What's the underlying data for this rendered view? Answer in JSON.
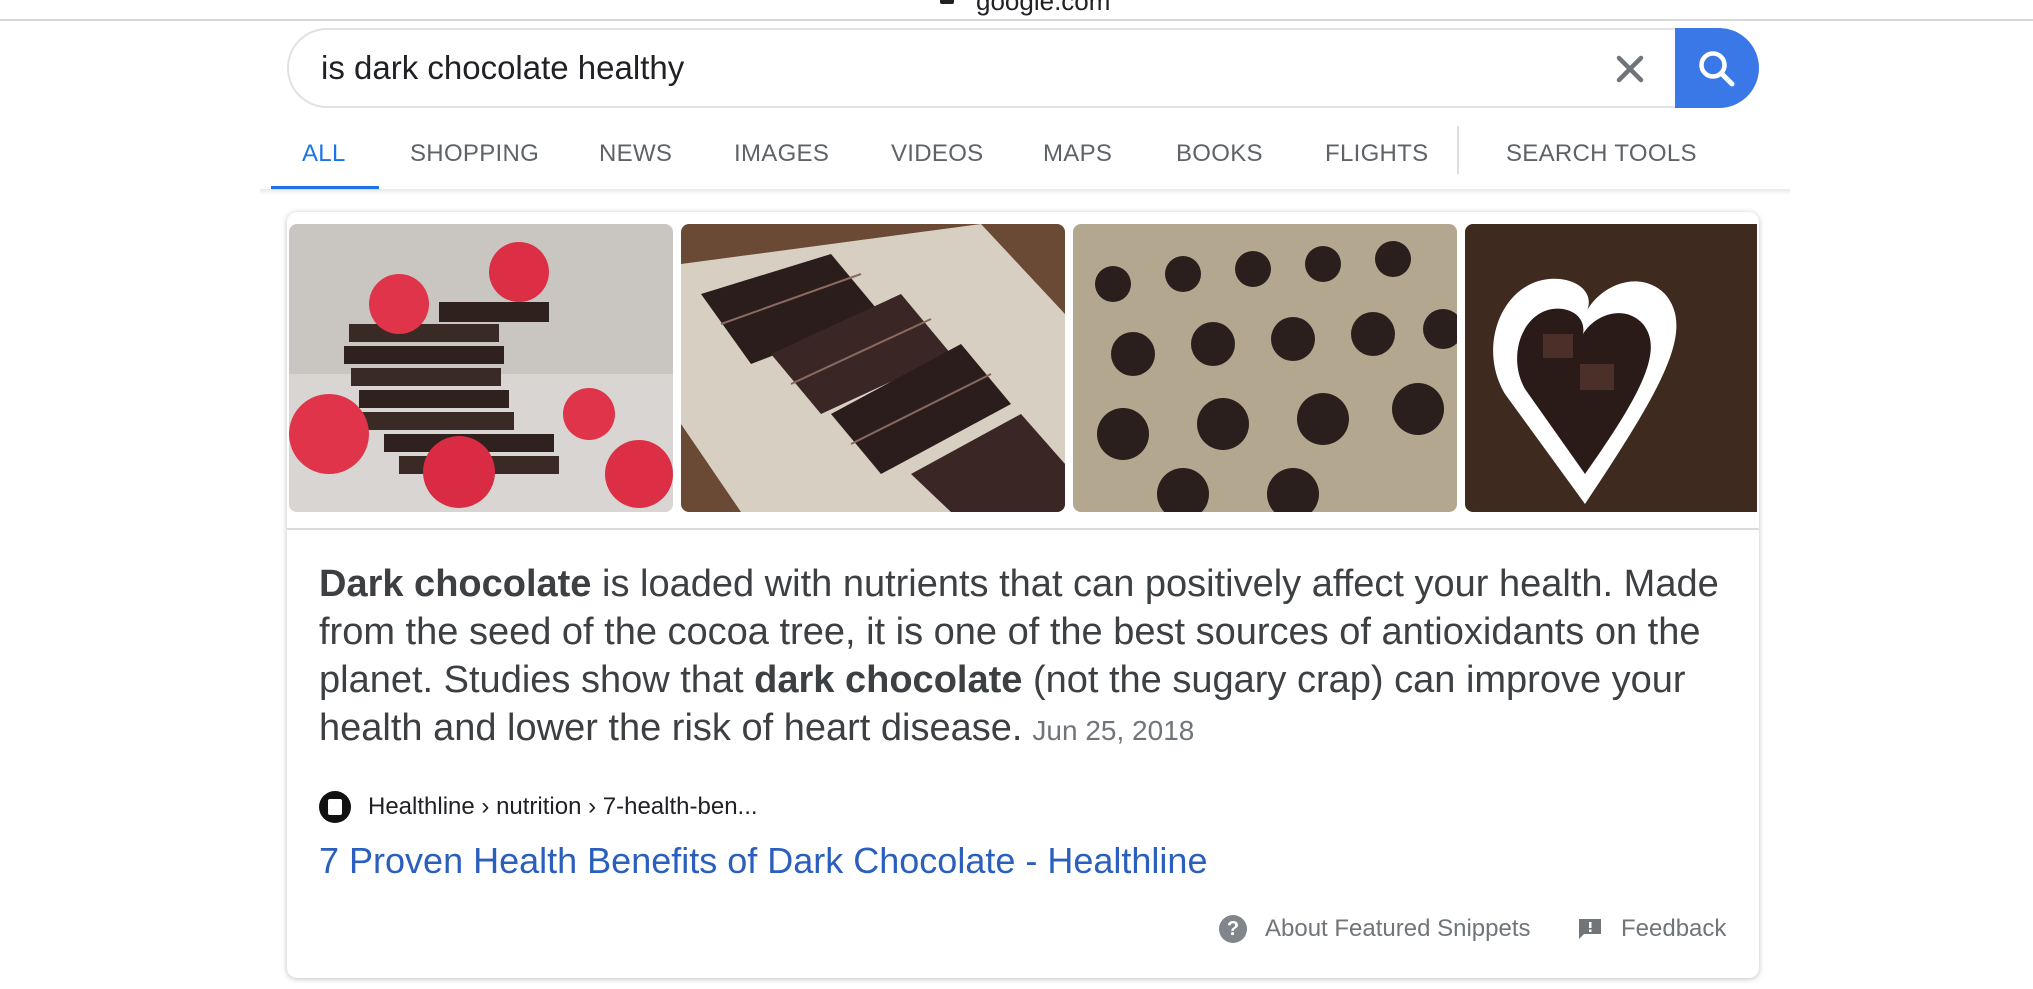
{
  "browser": {
    "url": "google.com"
  },
  "search": {
    "query": "is dark chocolate healthy",
    "clear_icon": "close-icon",
    "submit_icon": "search-icon",
    "accent": "#3b78e7"
  },
  "tabs": [
    {
      "label": "ALL",
      "active": true
    },
    {
      "label": "SHOPPING"
    },
    {
      "label": "NEWS"
    },
    {
      "label": "IMAGES"
    },
    {
      "label": "VIDEOS"
    },
    {
      "label": "MAPS"
    },
    {
      "label": "BOOKS"
    },
    {
      "label": "FLIGHTS"
    },
    {
      "label": "SEARCH TOOLS"
    }
  ],
  "snippet": {
    "lead_bold": "Dark chocolate",
    "text1": " is loaded with nutrients that can positively affect your health. Made from the seed of the cocoa tree, it is one of the best sources of antioxidants on the planet. Studies show that ",
    "mid_bold": "dark chocolate",
    "text2": " (not the sugary crap) can improve your health and lower the risk of heart disease.",
    "date": "Jun 25, 2018"
  },
  "source": {
    "breadcrumb": "Healthline › nutrition › 7-health-ben...",
    "title": "7 Proven Health Benefits of Dark Chocolate - Healthline",
    "link_color": "#2b5fbd"
  },
  "footer": {
    "about": "About Featured Snippets",
    "feedback": "Feedback"
  }
}
